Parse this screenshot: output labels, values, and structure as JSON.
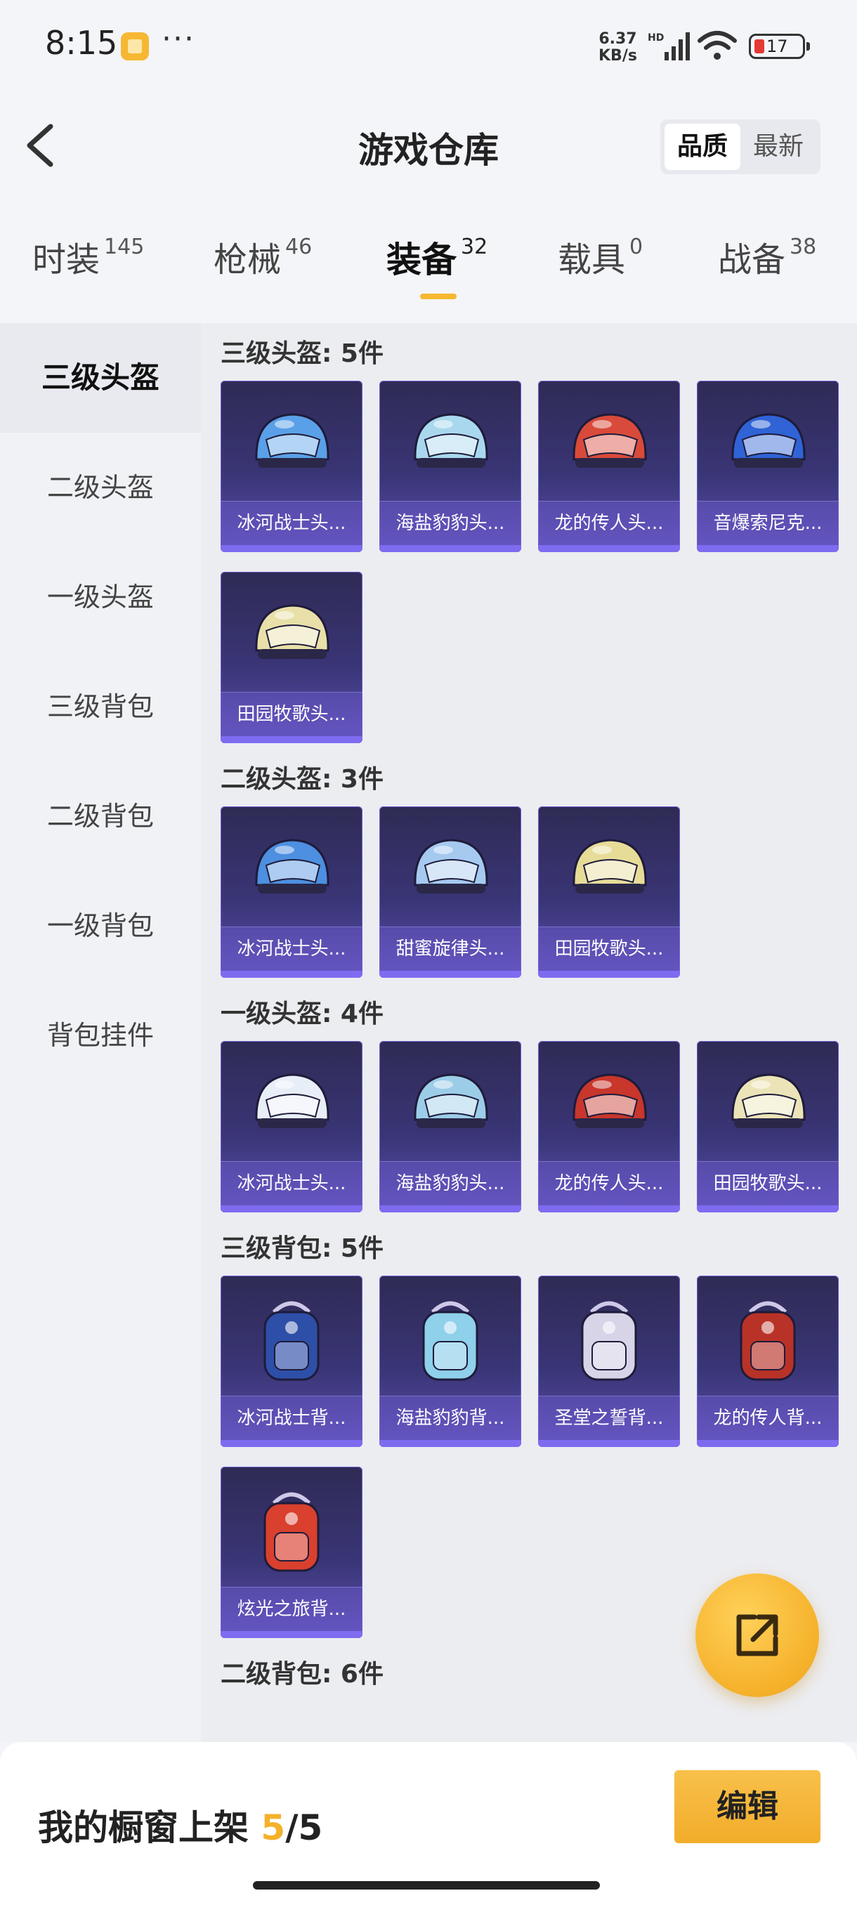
{
  "status_bar": {
    "time": "8:15",
    "more": "···",
    "net_speed_value": "6.37",
    "net_speed_unit": "KB/s",
    "network_badge": "HD",
    "battery": "17"
  },
  "header": {
    "title": "游戏仓库",
    "sort_options": [
      "品质",
      "最新"
    ],
    "sort_active": "品质"
  },
  "tabs": [
    {
      "label": "时装",
      "count": "145"
    },
    {
      "label": "枪械",
      "count": "46"
    },
    {
      "label": "装备",
      "count": "32"
    },
    {
      "label": "载具",
      "count": "0"
    },
    {
      "label": "战备",
      "count": "38"
    }
  ],
  "active_tab": "装备",
  "sidebar": {
    "items": [
      "三级头盔",
      "二级头盔",
      "一级头盔",
      "三级背包",
      "二级背包",
      "一级背包",
      "背包挂件"
    ],
    "active": "三级头盔"
  },
  "sections": [
    {
      "title": "三级头盔: 5件",
      "items": [
        {
          "name": "冰河战士头...",
          "icon": "helmet-icon",
          "color": "#5aa0e8"
        },
        {
          "name": "海盐豹豹头...",
          "icon": "helmet-icon",
          "color": "#a9d8ee"
        },
        {
          "name": "龙的传人头...",
          "icon": "helmet-icon",
          "color": "#d94a3a"
        },
        {
          "name": "音爆索尼克...",
          "icon": "helmet-icon",
          "color": "#2f63d6"
        },
        {
          "name": "田园牧歌头...",
          "icon": "helmet-icon",
          "color": "#e8e0a8"
        }
      ]
    },
    {
      "title": "二级头盔: 3件",
      "items": [
        {
          "name": "冰河战士头...",
          "icon": "helmet-icon",
          "color": "#4d8fe0"
        },
        {
          "name": "甜蜜旋律头...",
          "icon": "helmet-icon",
          "color": "#a6c9f0"
        },
        {
          "name": "田园牧歌头...",
          "icon": "helmet-icon",
          "color": "#e6dc98"
        }
      ]
    },
    {
      "title": "一级头盔: 4件",
      "items": [
        {
          "name": "冰河战士头...",
          "icon": "helmet-icon",
          "color": "#e8eef8"
        },
        {
          "name": "海盐豹豹头...",
          "icon": "helmet-icon",
          "color": "#9ccde8"
        },
        {
          "name": "龙的传人头...",
          "icon": "helmet-icon",
          "color": "#c8362c"
        },
        {
          "name": "田园牧歌头...",
          "icon": "helmet-icon",
          "color": "#ece4b8"
        }
      ]
    },
    {
      "title": "三级背包: 5件",
      "items": [
        {
          "name": "冰河战士背...",
          "icon": "backpack-icon",
          "color": "#2e4fa8"
        },
        {
          "name": "海盐豹豹背...",
          "icon": "backpack-icon",
          "color": "#8fd0ea"
        },
        {
          "name": "圣堂之誓背...",
          "icon": "backpack-icon",
          "color": "#d8d4e8"
        },
        {
          "name": "龙的传人背...",
          "icon": "backpack-icon",
          "color": "#b93228"
        },
        {
          "name": "炫光之旅背...",
          "icon": "backpack-icon",
          "color": "#d9402e"
        }
      ]
    },
    {
      "title": "二级背包: 6件",
      "items": []
    }
  ],
  "fab_icon": "share-icon",
  "bottom": {
    "label": "我的橱窗上架",
    "count": "5",
    "total": "/5",
    "edit": "编辑"
  }
}
